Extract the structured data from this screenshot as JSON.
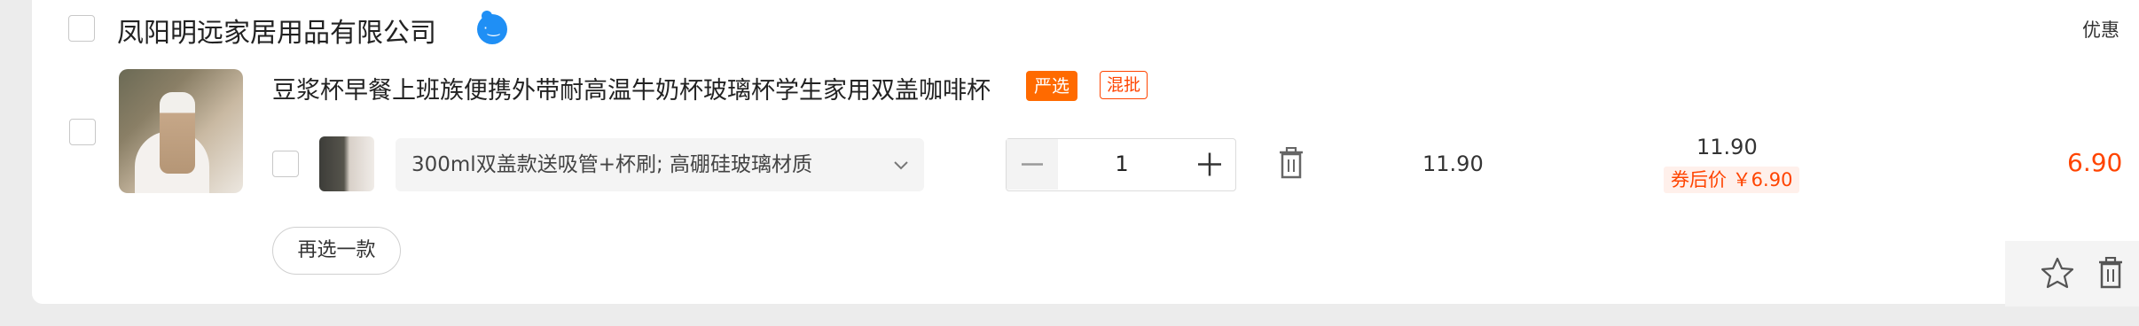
{
  "shop": {
    "name": "凤阳明远家居用品有限公司",
    "chat_icon": "wangwang-chat-icon",
    "discount_header": "优惠"
  },
  "item": {
    "title": "豆浆杯早餐上班族便携外带耐高温牛奶杯玻璃杯学生家用双盖咖啡杯",
    "tags": [
      "严选",
      "混批"
    ],
    "sku": "300ml双盖款送吸管+杯刷; 高硼硅玻璃材质",
    "quantity": "1",
    "unit_price": "11.90",
    "original_price": "11.90",
    "coupon_price": "券后价 ￥6.90",
    "subtotal": "6.90",
    "reselect_label": "再选一款"
  },
  "colors": {
    "accent": "#ff4400",
    "tag_orange": "#ff6a00",
    "chat_blue": "#1f8ff5"
  }
}
